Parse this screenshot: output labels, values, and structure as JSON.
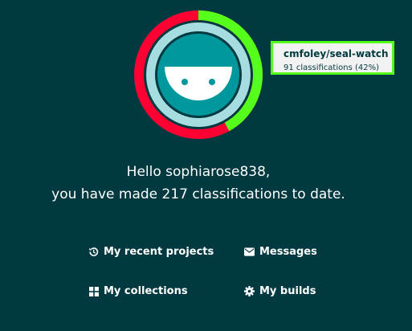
{
  "user": {
    "greeting_line1": "Hello sophiarose838,",
    "greeting_line2": "you have made 217 classifications to date."
  },
  "progress_ring": {
    "highlighted_project_fraction": 0.42,
    "colors": {
      "highlighted": "#56ff1b",
      "other": "#ff0033",
      "avatar_bg": "#00979d",
      "avatar_ring": "#a6dde0",
      "background": "#00393f"
    }
  },
  "tooltip": {
    "project": "cmfoley/seal-watch",
    "detail": "91 classifications (42%)"
  },
  "nav": {
    "recent_projects": {
      "label": "My recent projects",
      "icon": "history-icon"
    },
    "messages": {
      "label": "Messages",
      "icon": "envelope-icon"
    },
    "collections": {
      "label": "My collections",
      "icon": "grid-icon"
    },
    "builds": {
      "label": "My builds",
      "icon": "cog-icon"
    }
  }
}
